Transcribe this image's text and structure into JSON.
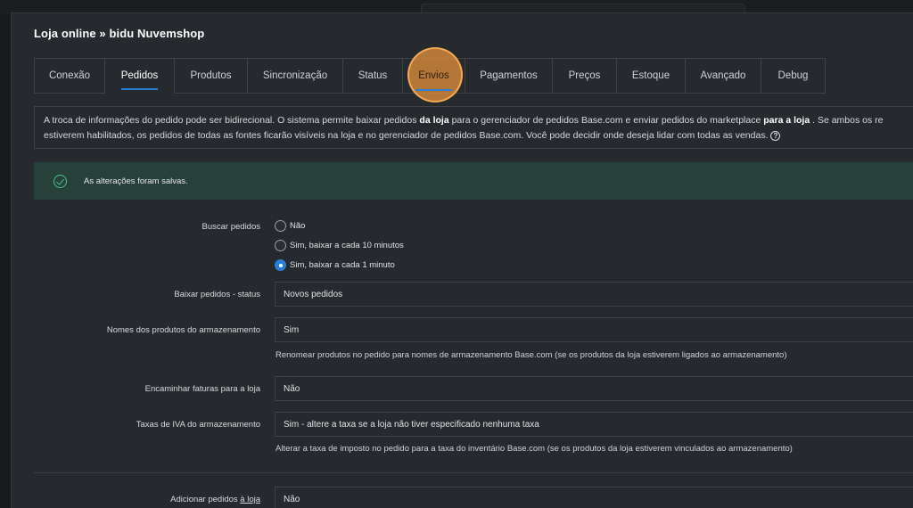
{
  "window": {
    "title": "Loja online » bidu Nuvemshop"
  },
  "tabs": [
    {
      "label": "Conexão"
    },
    {
      "label": "Pedidos"
    },
    {
      "label": "Produtos"
    },
    {
      "label": "Sincronização"
    },
    {
      "label": "Status"
    },
    {
      "label": "Envios"
    },
    {
      "label": "Pagamentos"
    },
    {
      "label": "Preços"
    },
    {
      "label": "Estoque"
    },
    {
      "label": "Avançado"
    },
    {
      "label": "Debug"
    }
  ],
  "active_tab": "Pedidos",
  "highlighted_tab": "Envios",
  "info": {
    "part1": "A troca de informações do pedido pode ser bidirecional. O sistema permite baixar pedidos ",
    "bold1": "da loja",
    "part2": " para o gerenciador de pedidos Base.com e enviar pedidos do marketplace ",
    "bold2": "para a loja",
    "part3": " . Se ambos os re",
    "line2": "estiverem habilitados, os pedidos de todas as fontes ficarão visíveis na loja e no gerenciador de pedidos Base.com. Você pode decidir onde deseja lidar com todas as vendas.",
    "help_glyph": "?"
  },
  "alert": {
    "text": "As alterações foram salvas."
  },
  "form": {
    "buscar_pedidos": {
      "label": "Buscar pedidos",
      "options": [
        "Não",
        "Sim, baixar a cada 10 minutos",
        "Sim, baixar a cada 1 minuto"
      ],
      "selected_index": 2
    },
    "baixar_status": {
      "label": "Baixar pedidos - status",
      "value": "Novos pedidos"
    },
    "nomes_produtos": {
      "label": "Nomes dos produtos do armazenamento",
      "value": "Sim",
      "hint": "Renomear produtos no pedido para nomes de armazenamento Base.com (se os produtos da loja estiverem ligados ao armazenamento)"
    },
    "encaminhar_faturas": {
      "label": "Encaminhar faturas para a loja",
      "value": "Não"
    },
    "taxas_iva": {
      "label": "Taxas de IVA do armazenamento",
      "value": "Sim - altere a taxa se a loja não tiver especificado nenhuma taxa",
      "hint": "Alterar a taxa de imposto no pedido para a taxa do inventário Base.com (se os produtos da loja estiverem vinculados ao armazenamento)"
    },
    "adicionar_pedidos": {
      "label_prefix": "Adicionar pedidos ",
      "label_link": "à loja",
      "value": "Não"
    }
  },
  "colors": {
    "accent": "#2a7fd4",
    "success": "#4cc28a",
    "highlight": "#eb963c"
  }
}
